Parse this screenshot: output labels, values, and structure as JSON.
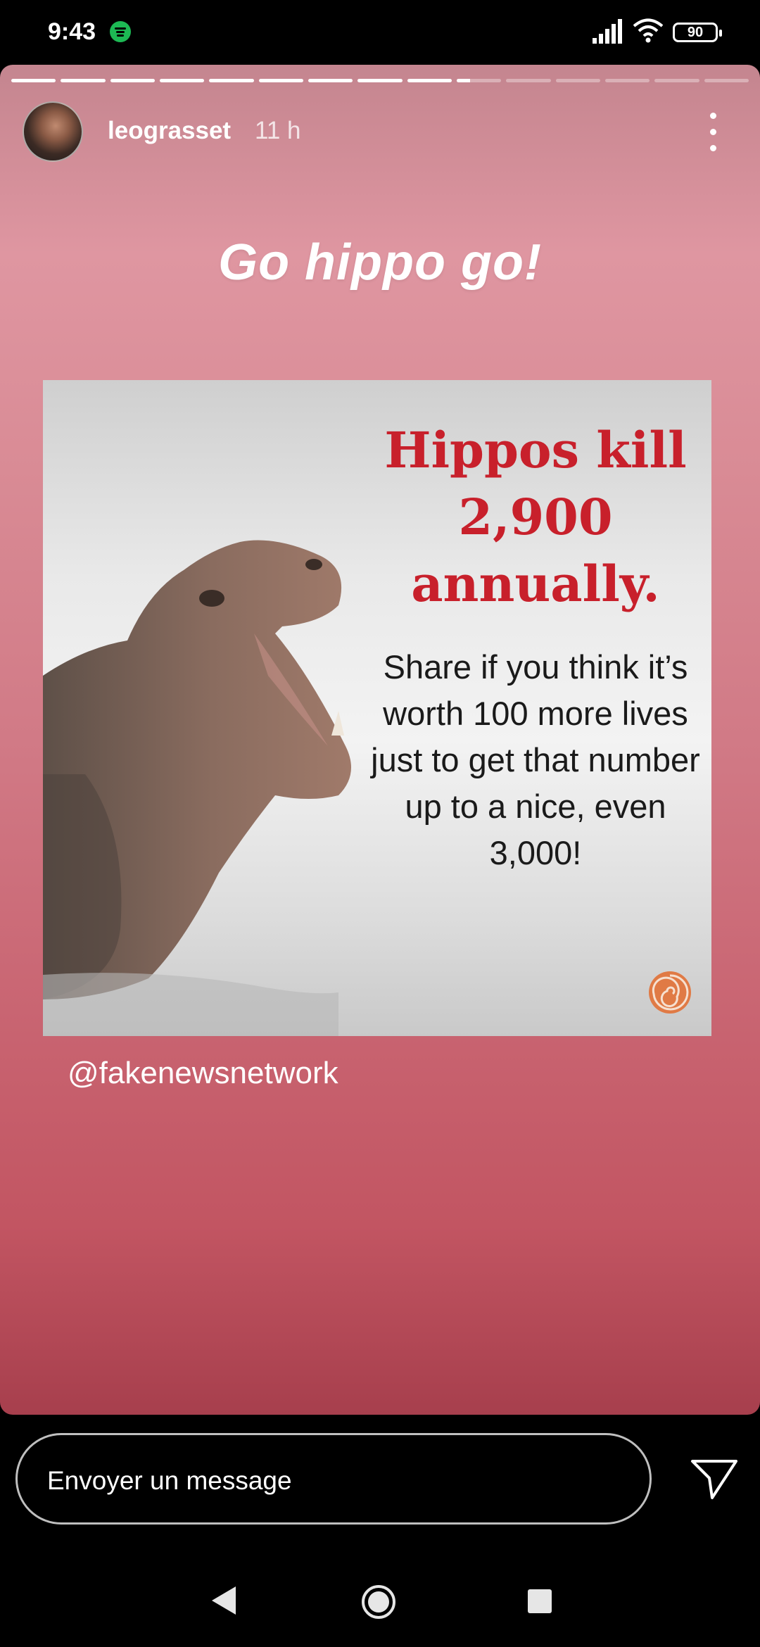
{
  "status_bar": {
    "time": "9:43",
    "battery": "90"
  },
  "story": {
    "progress": {
      "segments": 15,
      "current_index": 9,
      "current_fraction": 0.3
    },
    "username": "leograsset",
    "time_ago": "11 h",
    "headline": "Go hippo go!",
    "meme": {
      "title": "Hippos kill 2,900 annually.",
      "body": "Share if you think it’s worth 100 more lives just to get that number up to a nice, even 3,000!"
    },
    "mention": "@fakenewsnetwork"
  },
  "message_bar": {
    "placeholder": "Envoyer un message"
  },
  "colors": {
    "story_bg_top": "#df96a1",
    "story_bg_bottom": "#a73f4d",
    "meme_title": "#c8202b",
    "spotify": "#1DB954"
  }
}
